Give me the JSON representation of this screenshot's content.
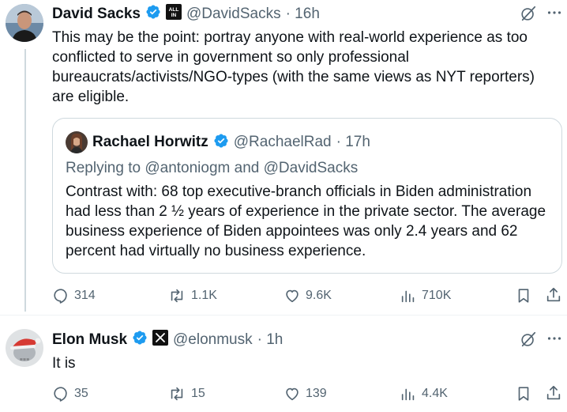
{
  "tweet1": {
    "name": "David Sacks",
    "handle": "@DavidSacks",
    "time": "· 16h",
    "affiliation_badge": "ALL IN",
    "text": "This may be the point: portray anyone with real-world experience as too conflicted to serve in government so only professional bureaucrats/activists/NGO-types (with the same views as NYT reporters) are eligible.",
    "quote": {
      "name": "Rachael Horwitz",
      "handle": "@RachaelRad",
      "time": "· 17h",
      "reply_prefix": "Replying to",
      "reply_users": "@antoniogm and @DavidSacks",
      "text": "Contrast with: 68 top executive-branch officials in Biden administration had less than 2 ½ years of experience in the private sector. The average business experience of Biden appointees was only 2.4 years and 62 percent had virtually no business experience."
    },
    "stats": {
      "replies": "314",
      "reposts": "1.1K",
      "likes": "9.6K",
      "views": "710K"
    }
  },
  "tweet2": {
    "name": "Elon Musk",
    "handle": "@elonmusk",
    "time": "· 1h",
    "text": "It is",
    "stats": {
      "replies": "35",
      "reposts": "15",
      "likes": "139",
      "views": "4.4K"
    }
  },
  "colors": {
    "verified": "#1d9bf0",
    "secondary": "#536471",
    "border": "#cfd9de"
  }
}
